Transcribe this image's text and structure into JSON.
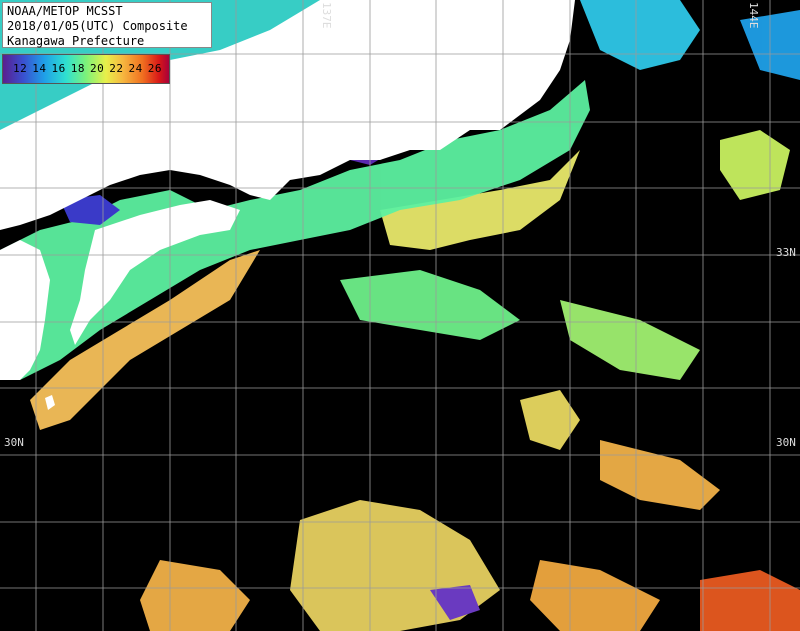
{
  "title": {
    "line1": "NOAA/METOP MCSST",
    "line2": "2018/01/05(UTC) Composite",
    "line3": "Kanagawa Prefecture"
  },
  "legend": {
    "ticks": [
      "12",
      "14",
      "16",
      "18",
      "20",
      "22",
      "24",
      "26"
    ],
    "low_color": "#5a1e8f",
    "high_color": "#a8003a"
  },
  "grid_labels": {
    "lat_33": "33N",
    "lat_30a": "30N",
    "lat_30b": "30N",
    "lon_137": "137E",
    "lon_144": "144E"
  },
  "colors": {
    "land": "#ffffff",
    "no_data": "#000000",
    "grid": "#9a9a9a"
  }
}
